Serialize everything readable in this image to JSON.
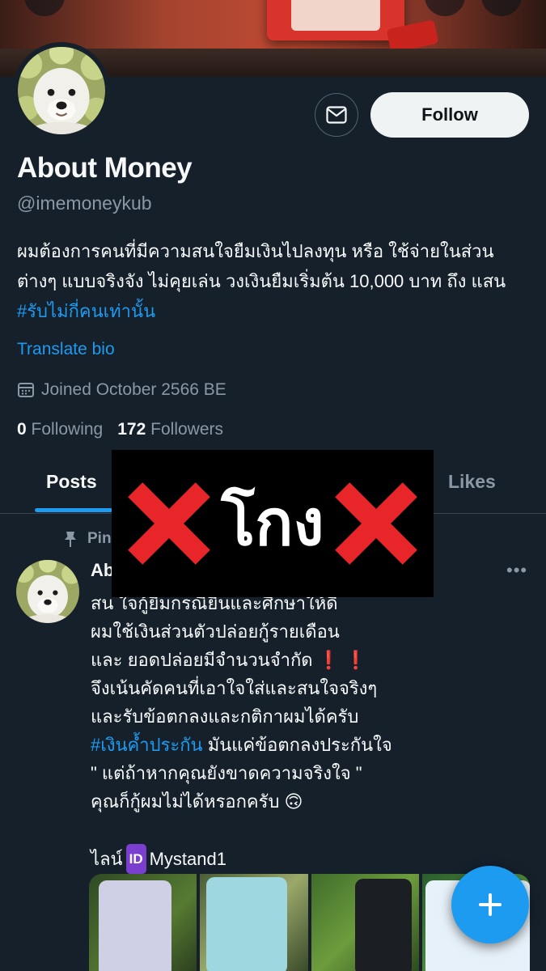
{
  "profile": {
    "name": "About Money",
    "handle": "@imemoneykub",
    "bio_text": "ผมต้องการคนที่มีความสนใจยืมเงินไปลงทุน หรือ ใช้จ่ายในส่วนต่างๆ แบบจริงจัง ไม่คุยเล่น วงเงินยืมเริ่มต้น 10,000 บาท ถึง แสน ",
    "bio_hashtag": "#รับไม่กี่คนเท่านั้น",
    "translate_label": "Translate bio",
    "joined": "Joined October 2566 BE",
    "following_count": "0",
    "following_label": "Following",
    "followers_count": "172",
    "followers_label": "Followers",
    "follow_label": "Follow"
  },
  "tabs": {
    "posts": "Posts",
    "likes": "Likes"
  },
  "overlay": {
    "word": "โกง",
    "color": "#e8262a"
  },
  "post": {
    "pinned_label": "Pinned",
    "author": "About Money",
    "more": "•••",
    "lines": {
      "l1": "สน ใจกู้ยืมกรณียืนและศึกษาให้ดี",
      "l2": "ผมใช้เงินส่วนตัวปล่อยกู้รายเดือน",
      "l3": "และ ยอดปล่อยมีจำนวนจำกัด ",
      "l3_emoji": "❗ ❗",
      "l4": "จึงเน้นคัดคนที่เอาใจใส่และสนใจจริงๆ",
      "l5": "และรับข้อตกลงและกติกาผมได้ครับ",
      "l6_hash": "#เงินค้ำประกัน",
      "l6_text": " มันแค่ข้อตกลงประกันใจ",
      "l7": "\" แต่ถ้าหากคุณยังขาดความจริงใจ \"",
      "l8": "คุณก็กู้ผมไม่ได้หรอกครับ 🙃",
      "l9_prefix": "ไลน์",
      "l9_badge": "ID",
      "l9_id": "Mystand1"
    }
  },
  "colors": {
    "background": "#15202b",
    "accent": "#1d9bf0",
    "muted": "#8b98a5"
  },
  "icons": {
    "message": "envelope-icon",
    "calendar": "calendar-icon",
    "pin": "pin-icon",
    "compose": "plus-icon"
  }
}
